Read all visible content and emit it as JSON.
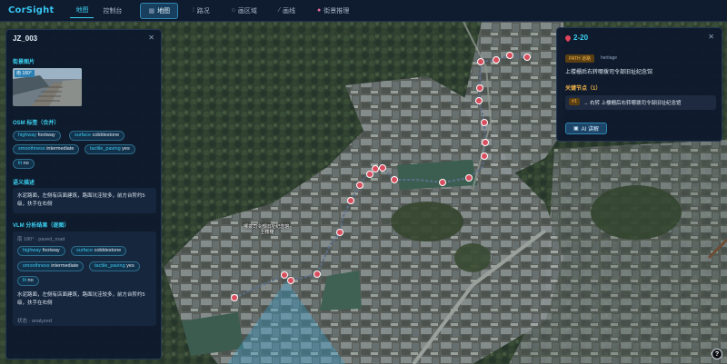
{
  "app": {
    "title": "CorSight"
  },
  "nav": {
    "items": [
      "地图",
      "控制台"
    ],
    "active": 0
  },
  "toolbar": {
    "map_label": "地图",
    "path_label": "路况",
    "area_label": "画区域",
    "line_label": "画线",
    "reasoning_label": "街景推理"
  },
  "left_panel": {
    "title": "JZ_003",
    "street_image_section": "街景图片",
    "thumb_caption": "南 180°",
    "osm_section": "OSM 标签（合并）",
    "osm_tags": [
      {
        "key": "highway",
        "value": "footway"
      },
      {
        "key": "surface",
        "value": "cobblestone"
      },
      {
        "key": "smoothness",
        "value": "intermediate"
      },
      {
        "key": "tactile_paving",
        "value": "yes"
      },
      {
        "key": "lit",
        "value": "no"
      }
    ],
    "semantic_section": "语义描述",
    "semantic_text": "水泥路面，左侧有店面建筑，路面坑洼较多，前方台阶约5级，扶手在右侧",
    "vlm_section": "VLM 分析结果（逐图）",
    "vlm_header": "南 180° · paved_road",
    "vlm_tags": [
      {
        "key": "highway",
        "value": "footway"
      },
      {
        "key": "surface",
        "value": "cobblestone"
      },
      {
        "key": "smoothness",
        "value": "intermediate"
      },
      {
        "key": "tactile_paving",
        "value": "yes"
      },
      {
        "key": "lit",
        "value": "no"
      }
    ],
    "vlm_text": "水泥路面，左侧有店面建筑，路面坑洼较多，前方台阶约5级，扶手在右侧",
    "status": "状态 · analyzed"
  },
  "right_panel": {
    "title": "2-20",
    "badge_path": "PATH 道路",
    "badge_type": "heritage",
    "place_name": "上楼栅后右转哪拨司令部旧址纪念馆",
    "key_nodes_section": "关键节点（1）",
    "node_index": "#1",
    "node_text": "→ 右转 上楼栅后右转哪拨司令部旧址纪念馆",
    "ai_button": "AI 讲解"
  },
  "map": {
    "label": "哪拨司令部旧址纪念馆·上楼栅",
    "help_label": "?"
  },
  "colors": {
    "accent": "#3bd0f0",
    "route": "#d94e5e",
    "panel_bg": "#0e1a2d"
  }
}
